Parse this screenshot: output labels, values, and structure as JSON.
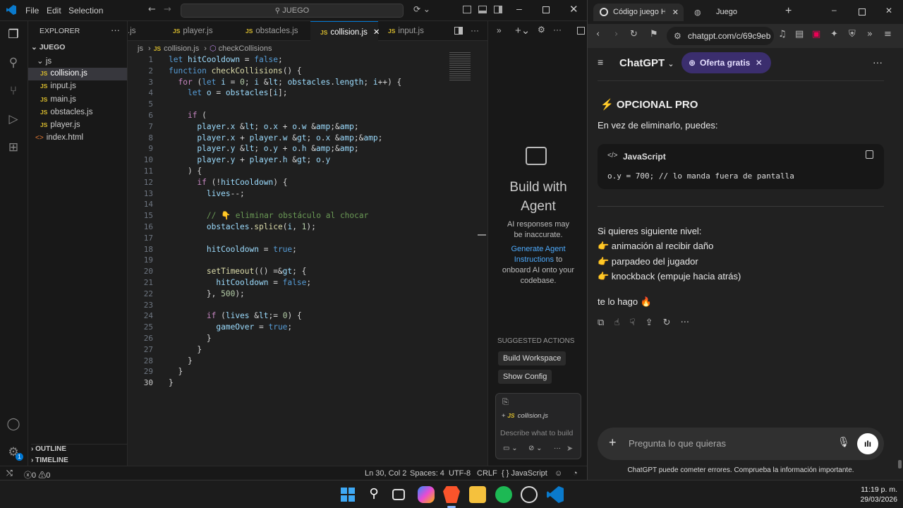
{
  "vscode": {
    "menu": [
      "File",
      "Edit",
      "Selection"
    ],
    "search": "JUEGO",
    "explorer_title": "EXPLORER",
    "project": "JUEGO",
    "folder": "js",
    "files": [
      "collision.js",
      "input.js",
      "main.js",
      "obstacles.js",
      "player.js"
    ],
    "index": "index.html",
    "outline": "OUTLINE",
    "timeline": "TIMELINE",
    "tabs": [
      ".js",
      "player.js",
      "obstacles.js",
      "collision.js",
      "input.js"
    ],
    "breadcrumb": [
      "js",
      "collision.js",
      "checkCollisions"
    ],
    "code_lines": [
      "let hitCooldown = false;",
      "function checkCollisions() {",
      "  for (let i = 0; i < obstacles.length; i++) {",
      "    let o = obstacles[i];",
      "",
      "    if (",
      "      player.x < o.x + o.w &&",
      "      player.x + player.w > o.x &&",
      "      player.y < o.y + o.h &&",
      "      player.y + player.h > o.y",
      "    ) {",
      "      if (!hitCooldown) {",
      "        lives--;",
      "",
      "        // 👇 eliminar obstáculo al chocar",
      "        obstacles.splice(i, 1);",
      "",
      "        hitCooldown = true;",
      "",
      "        setTimeout(() => {",
      "          hitCooldown = false;",
      "        }, 500);",
      "",
      "        if (lives <= 0) {",
      "          gameOver = true;",
      "        }",
      "      }",
      "    }",
      "  }",
      "}"
    ],
    "agent": {
      "title": "Build with Agent",
      "disclaimer": "AI responses may be inaccurate.",
      "link": "Generate Agent Instructions",
      "link_rest": "to onboard AI onto your codebase.",
      "suggested": "SUGGESTED ACTIONS",
      "actions": [
        "Build Workspace",
        "Show Config"
      ],
      "context_file": "collision.js",
      "placeholder": "Describe what to build"
    },
    "status": {
      "errors": "0",
      "warnings": "0",
      "position": "Ln 30, Col 2",
      "spaces": "Spaces: 4",
      "encoding": "UTF-8",
      "eol": "CRLF",
      "language": "JavaScript"
    }
  },
  "browser": {
    "tabs": [
      "Código juego HTML",
      "Juego"
    ],
    "url": "chatgpt.com/c/69c9eb",
    "app_name": "ChatGPT",
    "offer": "Oferta gratis",
    "heading": "⚡ OPCIONAL PRO",
    "intro": "En vez de eliminarlo, puedes:",
    "code_lang": "JavaScript",
    "code_line": "o.y = 700; // lo manda fuera de pantalla",
    "next_level": "Si quieres siguiente nivel:",
    "bullets": [
      "👉 animación al recibir daño",
      "👉 parpadeo del jugador",
      "👉 knockback (empuje hacia atrás)"
    ],
    "closing": "te lo hago 🔥",
    "input_placeholder": "Pregunta lo que quieras",
    "footer": "ChatGPT puede cometer errores. Comprueba la información importante."
  },
  "taskbar": {
    "time": "11:19 p. m.",
    "date": "29/03/2026"
  },
  "colors": {
    "vscode_accent": "#0078d4",
    "js_badge": "#d7ba2d",
    "offer_bg": "#3b2e6e",
    "link": "#4daafc"
  }
}
